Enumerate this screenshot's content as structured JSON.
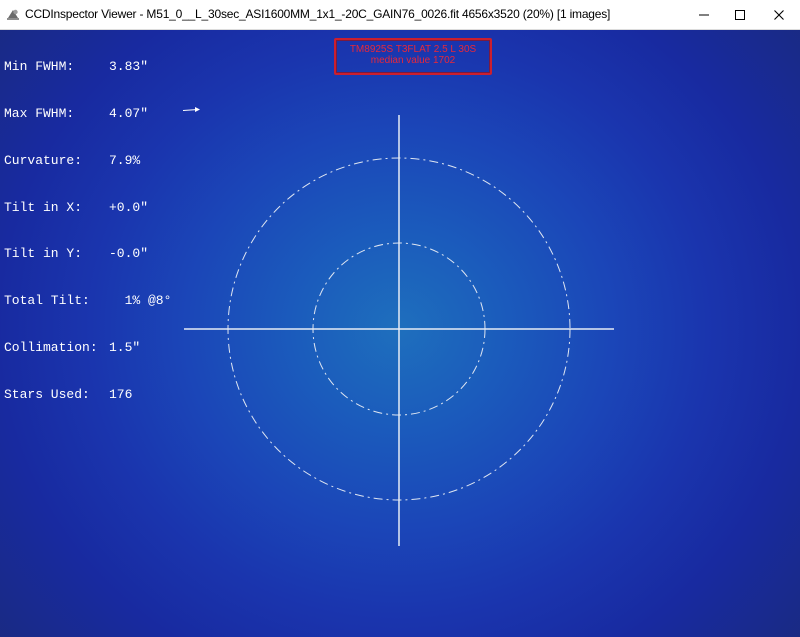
{
  "window": {
    "title": "CCDInspector Viewer - M51_0__L_30sec_ASI1600MM_1x1_-20C_GAIN76_0026.fit 4656x3520 (20%)  [1 images]",
    "controls": {
      "minimize": "minimize-icon",
      "maximize": "maximize-icon",
      "close": "close-icon"
    }
  },
  "stats": [
    {
      "label": "Min FWHM:",
      "value": "3.83\""
    },
    {
      "label": "Max FWHM:",
      "value": "4.07\""
    },
    {
      "label": "Curvature:",
      "value": "7.9%"
    },
    {
      "label": "Tilt in X:",
      "value": "+0.0\""
    },
    {
      "label": "Tilt in Y:",
      "value": "-0.0\""
    },
    {
      "label": "Total Tilt:",
      "value": "  1% @8°"
    },
    {
      "label": "Collimation:",
      "value": "1.5\""
    },
    {
      "label": "Stars Used:",
      "value": "176"
    }
  ],
  "info_box": {
    "line1": "TM8925S T3FLAT 2.5 L 30S",
    "line2": "median value 1702"
  },
  "colors": {
    "background_center": "#1e6fbd",
    "background_edge": "#1a2a7a",
    "overlay_lines": "#e6ecf5",
    "info_text": "#e8283a",
    "stats_text": "#ffffff"
  }
}
